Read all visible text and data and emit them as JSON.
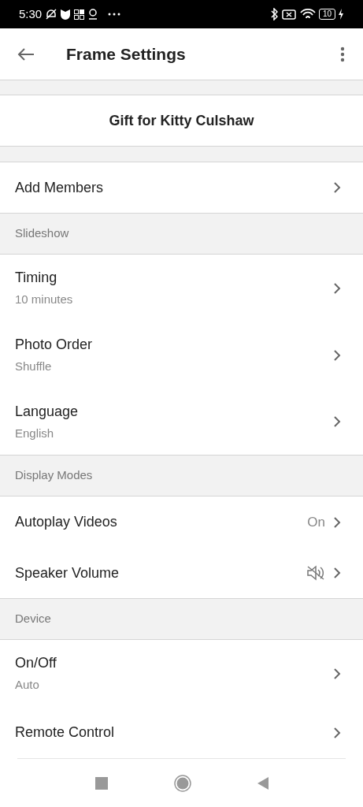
{
  "status_bar": {
    "time": "5:30",
    "battery": "10"
  },
  "app_bar": {
    "title": "Frame Settings"
  },
  "frame_name": "Gift for Kitty Culshaw",
  "items": [
    {
      "kind": "row",
      "label": "Add Members"
    },
    {
      "kind": "header",
      "label": "Slideshow"
    },
    {
      "kind": "row",
      "label": "Timing",
      "value": "10 minutes"
    },
    {
      "kind": "row",
      "label": "Photo Order",
      "value": "Shuffle"
    },
    {
      "kind": "row",
      "label": "Language",
      "value": "English"
    },
    {
      "kind": "header",
      "label": "Display Modes"
    },
    {
      "kind": "row",
      "label": "Autoplay Videos",
      "trailing": "On"
    },
    {
      "kind": "row",
      "label": "Speaker Volume",
      "muted": true
    },
    {
      "kind": "header",
      "label": "Device"
    },
    {
      "kind": "row",
      "label": "On/Off",
      "value": "Auto"
    },
    {
      "kind": "row",
      "label": "Remote Control"
    }
  ]
}
